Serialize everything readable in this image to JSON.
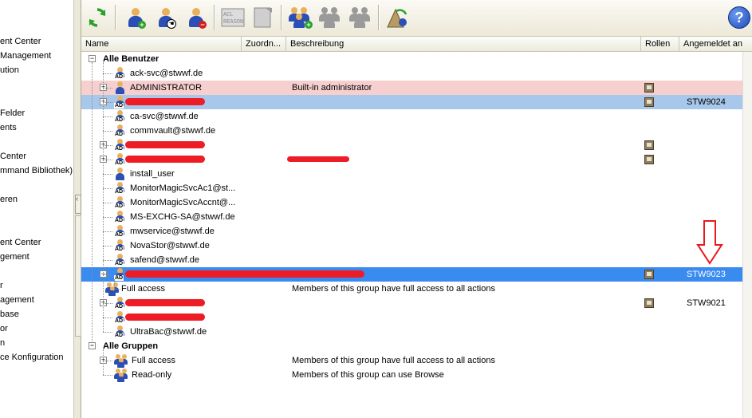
{
  "left_panel": {
    "items": [
      "ent Center",
      "Management",
      "ution",
      "",
      "Felder",
      "ents",
      "",
      "Center",
      "mmand Bibliothek)",
      "eren",
      "",
      "ent Center",
      "gement",
      "r",
      "agement",
      "base",
      "or",
      "n",
      "ce Konfiguration"
    ]
  },
  "toolbar": {
    "icons": [
      "refresh-icon",
      "add-user-icon",
      "edit-user-icon",
      "delete-user-icon",
      "acl-reason-icon",
      "note-edit-icon",
      "add-group-icon",
      "edit-group-icon",
      "delete-group-icon",
      "wizard-icon"
    ],
    "acl_text": "ACL",
    "reason_text": "REASON",
    "help_label": "?"
  },
  "columns": {
    "name": "Name",
    "assign": "Zuordn...",
    "desc": "Beschreibung",
    "roles": "Rollen",
    "logged": "Angemeldet an"
  },
  "tree": {
    "users_root": "Alle Benutzer",
    "groups_root": "Alle Gruppen",
    "expand_minus": "−",
    "expand_plus": "+"
  },
  "rows": [
    {
      "name": "ack-svc@stwwf.de",
      "icon": "ad",
      "desc": "",
      "role": false,
      "logged": "",
      "style": ""
    },
    {
      "name": "ADMINISTRATOR",
      "icon": "user",
      "desc": "Built-in administrator",
      "role": true,
      "logged": "",
      "style": "pink",
      "expand": true
    },
    {
      "name": "",
      "icon": "ad",
      "desc": "",
      "role": true,
      "logged": "STW9024",
      "style": "blue",
      "expand": true,
      "redact": true
    },
    {
      "name": "ca-svc@stwwf.de",
      "icon": "ad",
      "desc": "",
      "role": false,
      "logged": "",
      "style": ""
    },
    {
      "name": "commvault@stwwf.de",
      "icon": "ad",
      "desc": "",
      "role": false,
      "logged": "",
      "style": ""
    },
    {
      "name": "",
      "icon": "ad",
      "desc": "",
      "role": true,
      "logged": "",
      "style": "",
      "expand": true,
      "redact": true
    },
    {
      "name": "",
      "icon": "ad",
      "desc": "",
      "role": true,
      "logged": "",
      "style": "",
      "expand": true,
      "redact": true,
      "redact_desc": true
    },
    {
      "name": "install_user",
      "icon": "user",
      "desc": "",
      "role": false,
      "logged": "",
      "style": ""
    },
    {
      "name": "MonitorMagicSvcAc1@st...",
      "icon": "ad",
      "desc": "",
      "role": false,
      "logged": "",
      "style": ""
    },
    {
      "name": "MonitorMagicSvcAccnt@...",
      "icon": "ad",
      "desc": "",
      "role": false,
      "logged": "",
      "style": ""
    },
    {
      "name": "MS-EXCHG-SA@stwwf.de",
      "icon": "ad",
      "desc": "",
      "role": false,
      "logged": "",
      "style": ""
    },
    {
      "name": "mwservice@stwwf.de",
      "icon": "ad",
      "desc": "",
      "role": false,
      "logged": "",
      "style": ""
    },
    {
      "name": "NovaStor@stwwf.de",
      "icon": "ad",
      "desc": "",
      "role": false,
      "logged": "",
      "style": ""
    },
    {
      "name": "safend@stwwf.de",
      "icon": "ad",
      "desc": "",
      "role": false,
      "logged": "",
      "style": ""
    },
    {
      "name": "",
      "icon": "ad",
      "desc": "",
      "role": true,
      "logged": "STW9023",
      "style": "sel",
      "expand": true,
      "expanded": true,
      "redact": true,
      "redact_wide": true
    },
    {
      "name": "Full access",
      "icon": "group",
      "desc": "Members of this group have full access to all actions",
      "role": false,
      "logged": "",
      "style": "",
      "child": true
    },
    {
      "name": "",
      "icon": "ad",
      "desc": "",
      "role": true,
      "logged": "STW9021",
      "style": "",
      "expand": true,
      "redact": true
    },
    {
      "name": "",
      "icon": "ad",
      "desc": "",
      "role": false,
      "logged": "",
      "style": "",
      "redact": true
    },
    {
      "name": "UltraBac@stwwf.de",
      "icon": "ad",
      "desc": "",
      "role": false,
      "logged": "",
      "style": ""
    }
  ],
  "groups": [
    {
      "name": "Full access",
      "desc": "Members of this group have full access to all actions",
      "expand": true
    },
    {
      "name": "Read-only",
      "desc": "Members of this group can use Browse",
      "expand": false
    }
  ],
  "colors": {
    "annotation_arrow": "#e8191f",
    "selection": "#3a8bf0",
    "pink_row": "#f6cfcf",
    "blue_row": "#a7c8eb"
  }
}
